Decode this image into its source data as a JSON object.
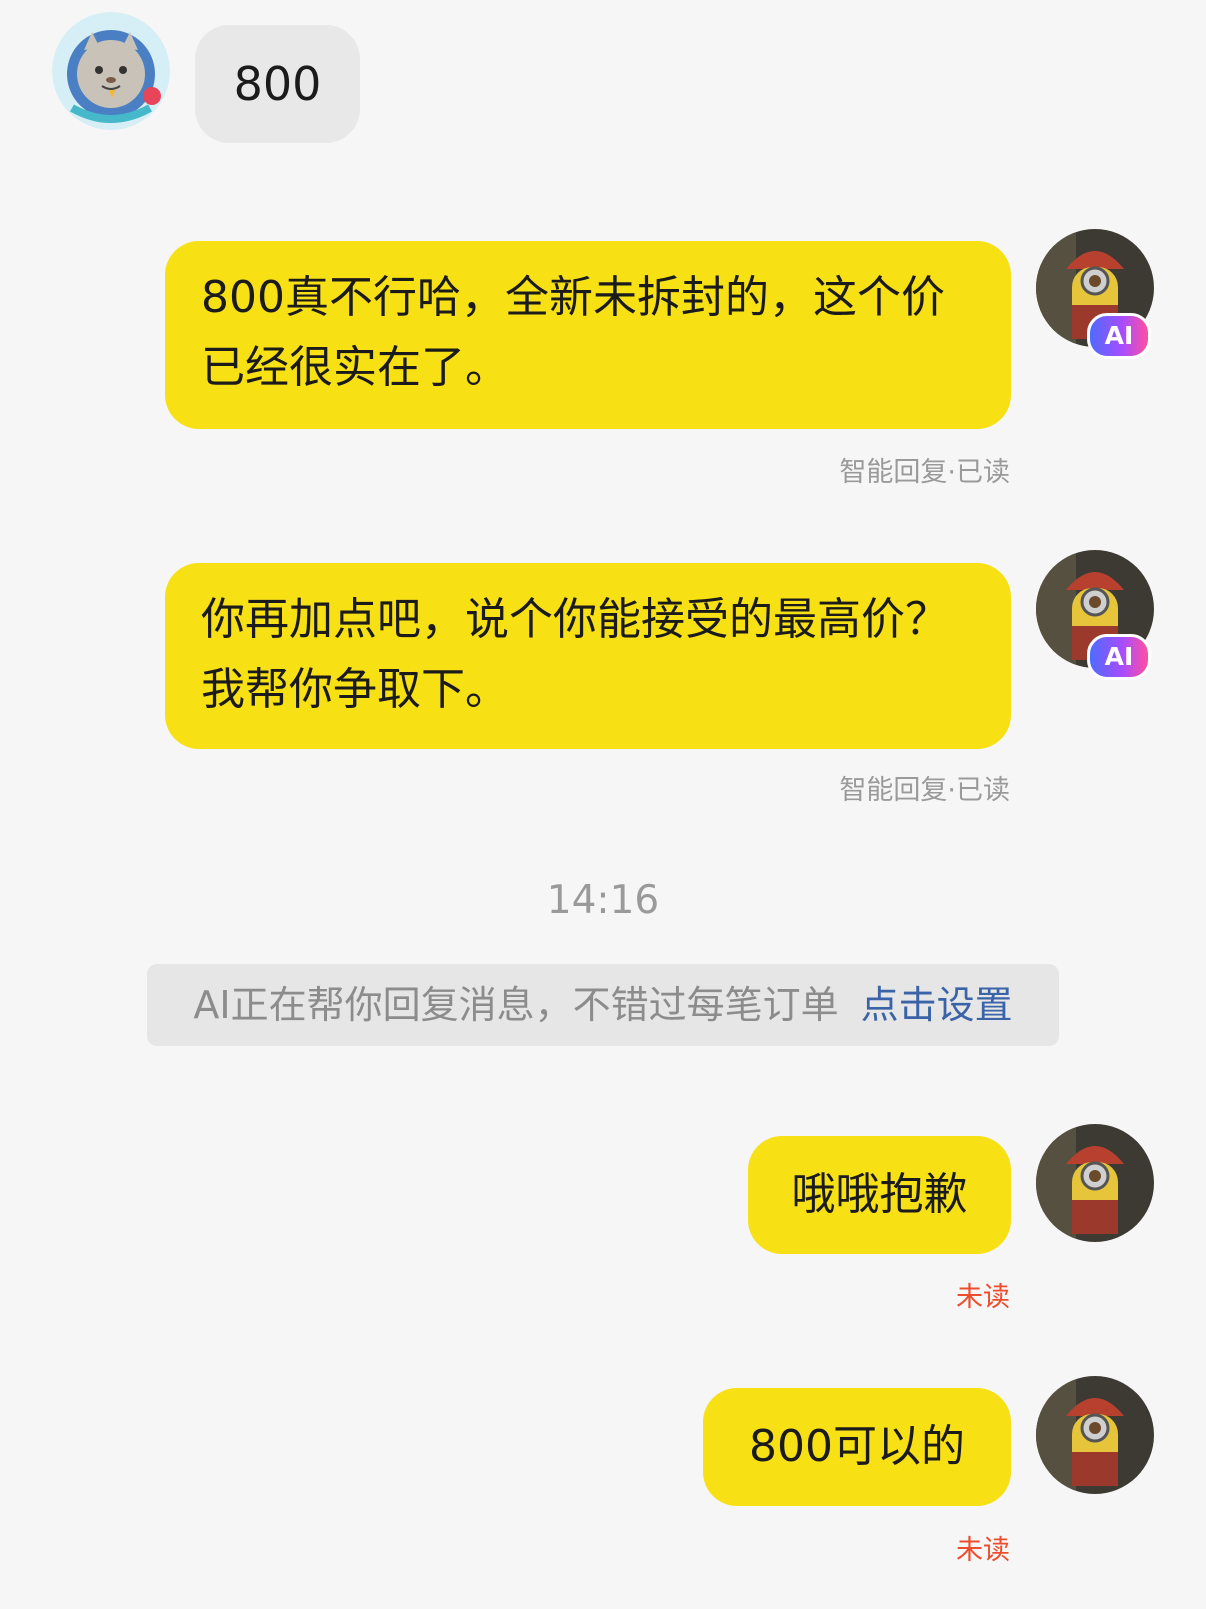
{
  "messages": {
    "m1": {
      "text": "800"
    },
    "m2": {
      "text": "800真不行哈，全新未拆封的，这个价已经很实在了。",
      "status": "智能回复·已读",
      "badge": "AI"
    },
    "m3": {
      "text": "你再加点吧，说个你能接受的最高价？我帮你争取下。",
      "status": "智能回复·已读",
      "badge": "AI"
    },
    "m4": {
      "text": "哦哦抱歉",
      "status": "未读"
    },
    "m5": {
      "text": "800可以的",
      "status": "未读"
    }
  },
  "timestamp": "14:16",
  "notice": {
    "text": "AI正在帮你回复消息，不错过每笔订单",
    "link": "点击设置"
  },
  "colors": {
    "seller_bubble": "#f7e014",
    "buyer_bubble": "#e8e8e8",
    "unread": "#ee4d2d",
    "link": "#3a63a8"
  },
  "icons": {
    "buyer_avatar": "cat-astronaut-avatar",
    "seller_avatar": "minion-samurai-avatar"
  }
}
